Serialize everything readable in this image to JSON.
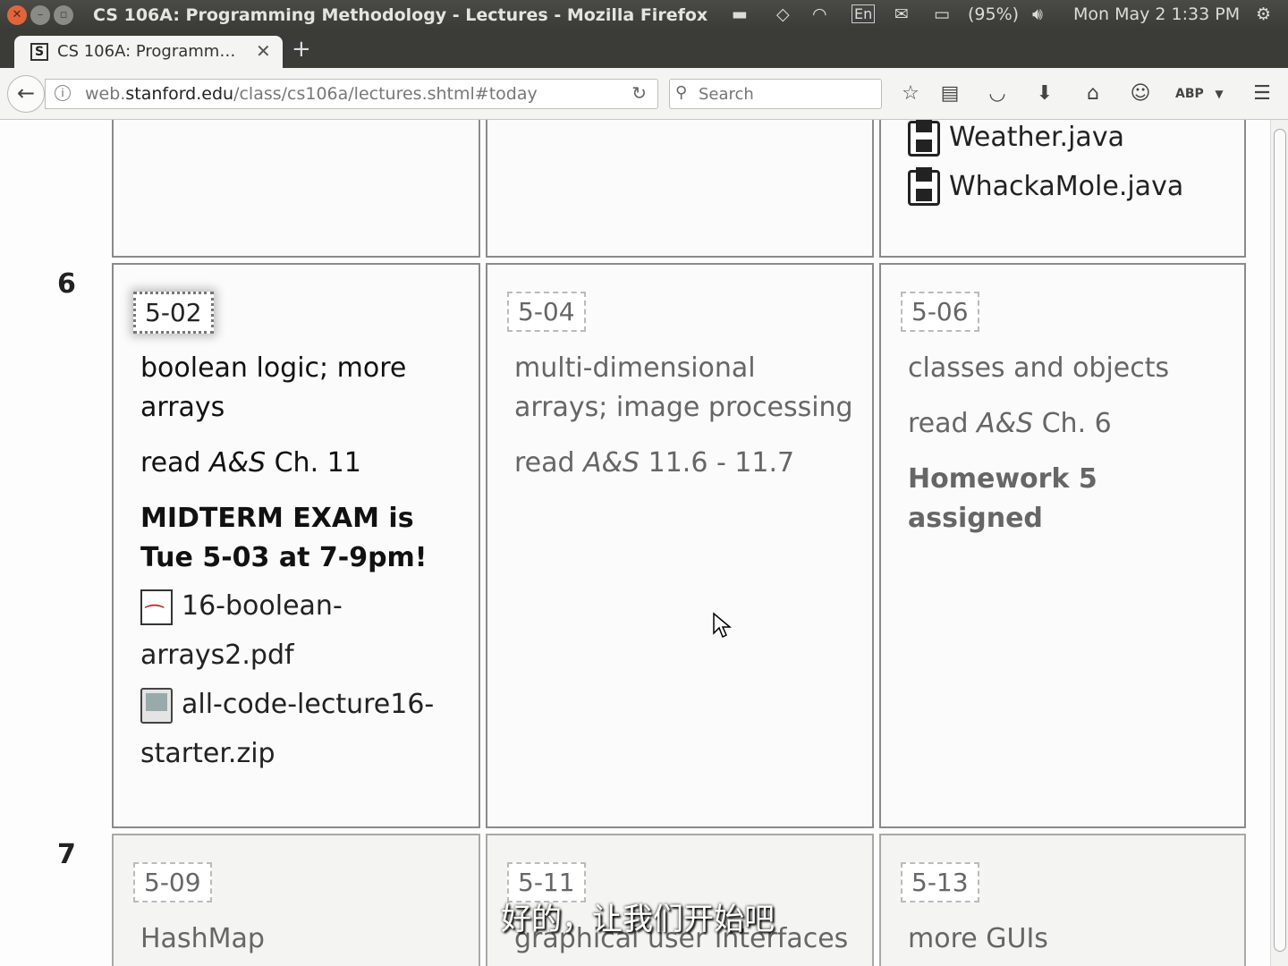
{
  "os": {
    "window_title": "CS 106A: Programming Methodology - Lectures - Mozilla Firefox",
    "lang_indicator": "En",
    "battery": "(95%)",
    "clock": "Mon May 2  1:33 PM"
  },
  "browser": {
    "tab_label": "CS 106A: Programm…",
    "url_host": "web.stanford.edu",
    "url_path": "/class/cs106a/lectures.shtml#today",
    "url_prefix": "web.",
    "url_domain": "stanford.edu",
    "search_placeholder": "Search"
  },
  "schedule": {
    "prev_row_files": [
      "Weather.java",
      "WhackaMole.java"
    ],
    "week6": {
      "number": "6",
      "mon": {
        "date": "5-02",
        "topic": "boolean logic; more arrays",
        "reading_prefix": "read ",
        "reading_book": "A&S",
        "reading_suffix": " Ch. 11",
        "note": "MIDTERM EXAM is Tue 5-03 at 7-9pm!",
        "file1": "16-boolean-arrays2.pdf",
        "file2": "all-code-lecture16-starter.zip"
      },
      "wed": {
        "date": "5-04",
        "topic": "multi-dimensional arrays; image processing",
        "reading_prefix": "read ",
        "reading_book": "A&S",
        "reading_suffix": " 11.6 - 11.7"
      },
      "fri": {
        "date": "5-06",
        "topic": "classes and objects",
        "reading_prefix": "read ",
        "reading_book": "A&S",
        "reading_suffix": " Ch. 6",
        "note": "Homework 5 assigned"
      }
    },
    "week7": {
      "number": "7",
      "mon": {
        "date": "5-09",
        "topic": "HashMap"
      },
      "wed": {
        "date": "5-11",
        "topic": "graphical user interfaces"
      },
      "fri": {
        "date": "5-13",
        "topic": "more GUIs"
      }
    }
  },
  "subtitle": "好的，让我们开始吧"
}
